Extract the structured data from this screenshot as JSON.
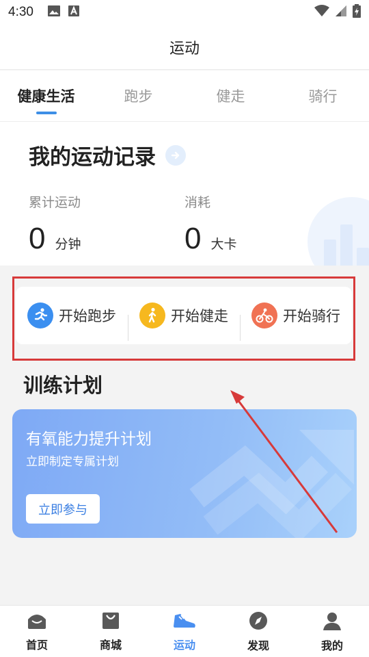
{
  "status": {
    "time": "4:30"
  },
  "title": "运动",
  "tabs": [
    {
      "label": "健康生活",
      "active": true
    },
    {
      "label": "跑步",
      "active": false
    },
    {
      "label": "健走",
      "active": false
    },
    {
      "label": "骑行",
      "active": false
    }
  ],
  "record": {
    "heading": "我的运动记录",
    "stats": [
      {
        "label": "累计运动",
        "value": "0",
        "unit": "分钟"
      },
      {
        "label": "消耗",
        "value": "0",
        "unit": "大卡"
      }
    ]
  },
  "quick_actions": [
    {
      "label": "开始跑步",
      "icon": "running-icon",
      "color": "#3b8ff0"
    },
    {
      "label": "开始健走",
      "icon": "walking-icon",
      "color": "#f6b81f"
    },
    {
      "label": "开始骑行",
      "icon": "cycling-icon",
      "color": "#f07254"
    }
  ],
  "plan": {
    "section_title": "训练计划",
    "card_title": "有氧能力提升计划",
    "card_subtitle": "立即制定专属计划",
    "button_label": "立即参与"
  },
  "bottom_nav": [
    {
      "label": "首页",
      "icon": "home-icon",
      "active": false
    },
    {
      "label": "商城",
      "icon": "shopping-bag-icon",
      "active": false
    },
    {
      "label": "运动",
      "icon": "sneaker-icon",
      "active": true
    },
    {
      "label": "发现",
      "icon": "compass-icon",
      "active": false
    },
    {
      "label": "我的",
      "icon": "user-icon",
      "active": false
    }
  ],
  "colors": {
    "accent": "#3d8fe6",
    "highlight_box": "#d73a3a",
    "annotation_arrow": "#d73a3a"
  }
}
